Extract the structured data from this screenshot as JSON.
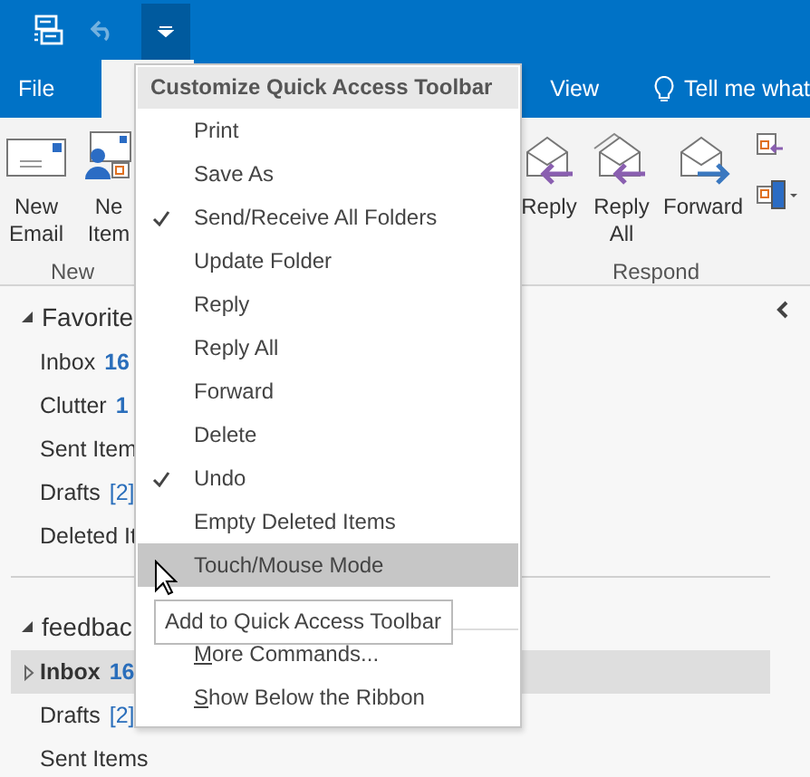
{
  "title_bar": {
    "quick_access": [
      {
        "kind": "sendreceive",
        "disabled": false
      },
      {
        "kind": "undo",
        "disabled": true
      },
      {
        "kind": "customize",
        "disabled": false
      }
    ]
  },
  "tabs": [
    {
      "label": "File",
      "kind": "file"
    },
    {
      "label": "View",
      "kind": "tab"
    },
    {
      "label": "Tell me what",
      "kind": "tellme"
    }
  ],
  "ribbon": {
    "left_buttons": [
      {
        "label": "New Email",
        "kind": "mail"
      },
      {
        "label": "Ne Item",
        "kind": "items"
      }
    ],
    "left_group": "New",
    "right_buttons": [
      {
        "label": "Reply",
        "kind": "reply"
      },
      {
        "label": "Reply All",
        "kind": "replyall"
      },
      {
        "label": "Forward",
        "kind": "forward"
      }
    ],
    "right_group": "Respond"
  },
  "folders": [
    {
      "header": "Favorite",
      "items": [
        {
          "name": "Inbox",
          "count": "16",
          "kind": "unread",
          "bold": false,
          "selected": false,
          "expandable": false
        },
        {
          "name": "Clutter",
          "count": "1",
          "kind": "unread",
          "bold": false,
          "selected": false,
          "expandable": false
        },
        {
          "name": "Sent Item",
          "bold": false,
          "selected": false,
          "expandable": false
        },
        {
          "name": "Drafts",
          "count": "[2]",
          "kind": "drafts",
          "bold": false,
          "selected": false,
          "expandable": false
        },
        {
          "name": "Deleted It",
          "bold": false,
          "selected": false,
          "expandable": false
        }
      ]
    },
    {
      "header": "feedbac",
      "items": [
        {
          "name": "Inbox",
          "count": "16",
          "kind": "unread",
          "bold": true,
          "selected": true,
          "expandable": true
        },
        {
          "name": "Drafts",
          "count": "[2]",
          "kind": "drafts",
          "bold": false,
          "selected": false,
          "expandable": false
        },
        {
          "name": "Sent Items",
          "bold": false,
          "selected": false,
          "expandable": false
        }
      ]
    }
  ],
  "menu": {
    "title": "Customize Quick Access Toolbar",
    "items": [
      {
        "label": "Print",
        "checked": false,
        "selected": false
      },
      {
        "label": "Save As",
        "checked": false,
        "selected": false
      },
      {
        "label": "Send/Receive All Folders",
        "checked": true,
        "selected": false
      },
      {
        "label": "Update Folder",
        "checked": false,
        "selected": false
      },
      {
        "label": "Reply",
        "checked": false,
        "selected": false
      },
      {
        "label": "Reply All",
        "checked": false,
        "selected": false
      },
      {
        "label": "Forward",
        "checked": false,
        "selected": false
      },
      {
        "label": "Delete",
        "checked": false,
        "selected": false
      },
      {
        "label": "Undo",
        "checked": true,
        "selected": false
      },
      {
        "label": "Empty Deleted Items",
        "checked": false,
        "selected": false
      },
      {
        "label": "Touch/Mouse Mode",
        "checked": false,
        "selected": true
      }
    ],
    "commands": [
      {
        "key": "M",
        "rest": "ore Commands..."
      },
      {
        "key": "S",
        "rest": "how Below the Ribbon"
      }
    ]
  },
  "tooltip": "Add to Quick Access Toolbar"
}
